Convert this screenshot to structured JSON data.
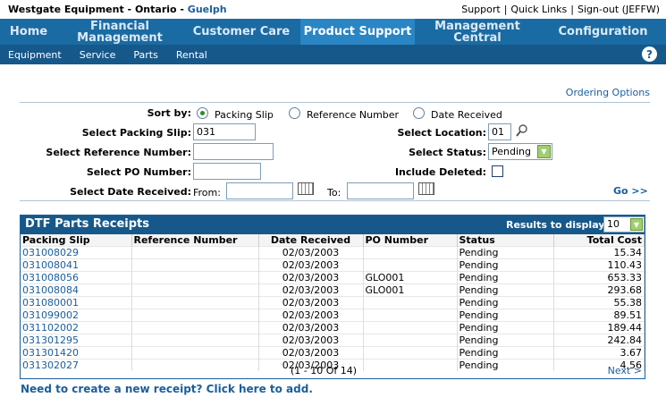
{
  "header": {
    "company": "Westgate Equipment - Ontario - ",
    "location": "Guelph",
    "links": [
      "Support",
      "Quick Links",
      "Sign-out (JEFFW)"
    ]
  },
  "main_nav": [
    {
      "label": "Home"
    },
    {
      "label": "Financial Management"
    },
    {
      "label": "Customer Care"
    },
    {
      "label": "Product Support",
      "active": true
    },
    {
      "label": "Management Central"
    },
    {
      "label": "Configuration"
    }
  ],
  "sub_nav": [
    "Equipment",
    "Service",
    "Parts",
    "Rental"
  ],
  "help_label": "?",
  "ordering_options": "Ordering Options",
  "form": {
    "sort_by_label": "Sort by:",
    "sort_options": [
      "Packing Slip",
      "Reference Number",
      "Date Received"
    ],
    "packing_slip_label": "Select Packing Slip:",
    "packing_slip_value": "031",
    "reference_label": "Select Reference Number:",
    "reference_value": "",
    "po_label": "Select PO Number:",
    "po_value": "",
    "date_label": "Select Date Received:",
    "from_label": "From:",
    "to_label": "To:",
    "location_label": "Select Location:",
    "location_value": "01",
    "status_label": "Select Status:",
    "status_value": "Pending",
    "include_deleted_label": "Include Deleted:",
    "go_label": "Go >>"
  },
  "results": {
    "title": "DTF Parts Receipts",
    "results_label": "Results to display:",
    "results_value": "10",
    "columns": [
      "Packing Slip",
      "Reference Number",
      "Date Received",
      "PO Number",
      "Status",
      "Total Cost"
    ],
    "rows": [
      [
        "031008029",
        "",
        "02/03/2003",
        "",
        "Pending",
        "15.34"
      ],
      [
        "031008041",
        "",
        "02/03/2003",
        "",
        "Pending",
        "110.43"
      ],
      [
        "031008056",
        "",
        "02/03/2003",
        "GLO001",
        "Pending",
        "653.33"
      ],
      [
        "031008084",
        "",
        "02/03/2003",
        "GLO001",
        "Pending",
        "293.68"
      ],
      [
        "031080001",
        "",
        "02/03/2003",
        "",
        "Pending",
        "55.38"
      ],
      [
        "031099002",
        "",
        "02/03/2003",
        "",
        "Pending",
        "89.51"
      ],
      [
        "031102002",
        "",
        "02/03/2003",
        "",
        "Pending",
        "189.44"
      ],
      [
        "031301295",
        "",
        "02/03/2003",
        "",
        "Pending",
        "242.84"
      ],
      [
        "031301420",
        "",
        "02/03/2003",
        "",
        "Pending",
        "3.67"
      ],
      [
        "031302027",
        "",
        "02/03/2003",
        "",
        "Pending",
        "4.56"
      ]
    ],
    "pager_text": "(1 - 10 Of 14)",
    "next_label": "Next >"
  },
  "new_receipt_link": "Need to create a new receipt? Click here to add."
}
